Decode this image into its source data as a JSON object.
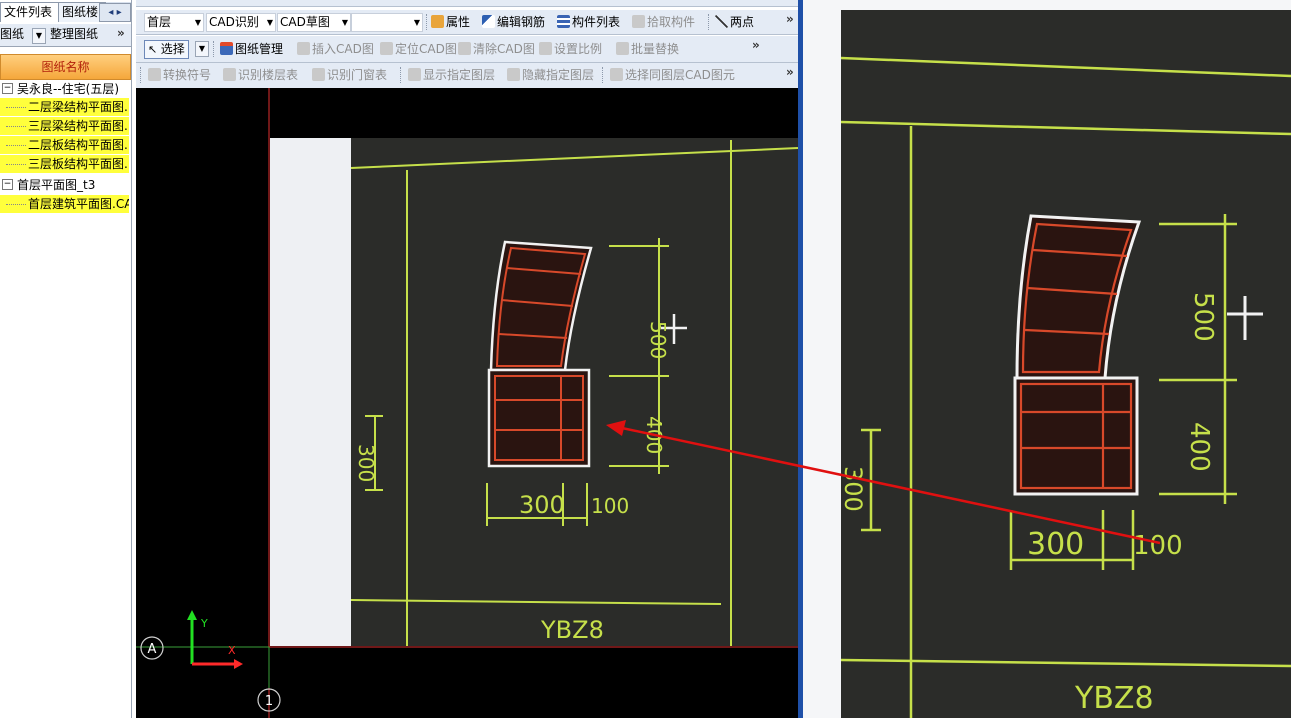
{
  "left_panel": {
    "tabs": [
      "文件列表",
      "图纸楼"
    ],
    "tab_arrows": "◂ ▸",
    "tools": {
      "drawing_btn": "图纸",
      "organize_btn": "整理图纸"
    },
    "column_header": "图纸名称",
    "tree": [
      {
        "label": "吴永良--住宅(五层)",
        "level": 0,
        "toggle": "−",
        "selected": false
      },
      {
        "label": "二层梁结构平面图.",
        "level": 1,
        "selected": true
      },
      {
        "label": "三层梁结构平面图.",
        "level": 1,
        "selected": true
      },
      {
        "label": "二层板结构平面图.",
        "level": 1,
        "selected": true
      },
      {
        "label": "三层板结构平面图.",
        "level": 1,
        "selected": true
      },
      {
        "label": "首层平面图_t3",
        "level": 0,
        "toggle": "−",
        "selected": false
      },
      {
        "label": "首层建筑平面图.CA",
        "level": 1,
        "selected": true
      }
    ]
  },
  "toolbar1": {
    "floor": "首层",
    "mode": "CAD识别",
    "sketch": "CAD草图",
    "blank_combo": "",
    "items": [
      "属性",
      "编辑钢筋",
      "构件列表",
      "拾取构件",
      "两点"
    ]
  },
  "toolbar2": {
    "select": "选择",
    "items": [
      "图纸管理",
      "插入CAD图",
      "定位CAD图",
      "清除CAD图",
      "设置比例",
      "批量替换"
    ]
  },
  "toolbar3": {
    "items": [
      "转换符号",
      "识别楼层表",
      "识别门窗表",
      "显示指定图层",
      "隐藏指定图层",
      "选择同图层CAD图元"
    ]
  },
  "overflow_chevron": "»",
  "canvas": {
    "axis_circle_a": "A",
    "axis_circle_1": "1",
    "axis_x": "X",
    "axis_y": "Y"
  },
  "photo": {
    "dim_300": "300",
    "dim_100": "100",
    "dim_500": "500",
    "dim_400": "400",
    "dim_side": "300",
    "column_label": "YBZ8"
  },
  "colors": {
    "cad_green": "#c6e04a",
    "rebar_red": "#d8492a",
    "outline_white": "#f2f2f2",
    "arrow_red": "#e01010",
    "selected_row": "#ffff3c",
    "header_orange": "#f5a73b"
  }
}
